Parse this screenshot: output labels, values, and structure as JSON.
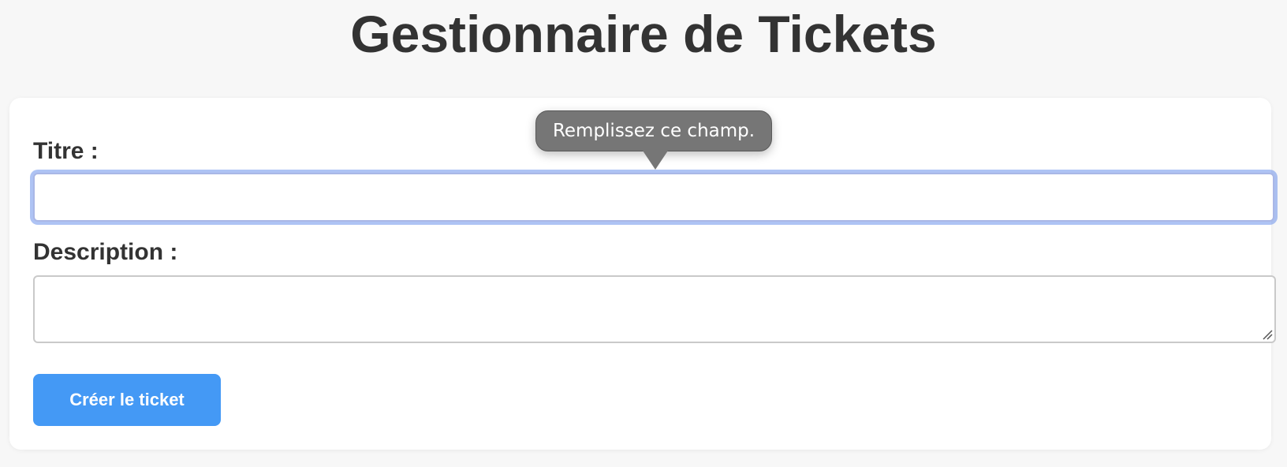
{
  "page": {
    "title": "Gestionnaire de Tickets"
  },
  "form": {
    "title_label": "Titre :",
    "title_value": "",
    "description_label": "Description :",
    "description_value": "",
    "submit_label": "Créer le ticket"
  },
  "validation": {
    "tooltip_message": "Remplissez ce champ."
  },
  "colors": {
    "accent": "#4499f5",
    "focus_ring": "#6c92eb",
    "tooltip_bg": "#767676",
    "text": "#333333",
    "background": "#f7f7f7"
  },
  "icons": {
    "resize": "resize-grip-icon"
  }
}
